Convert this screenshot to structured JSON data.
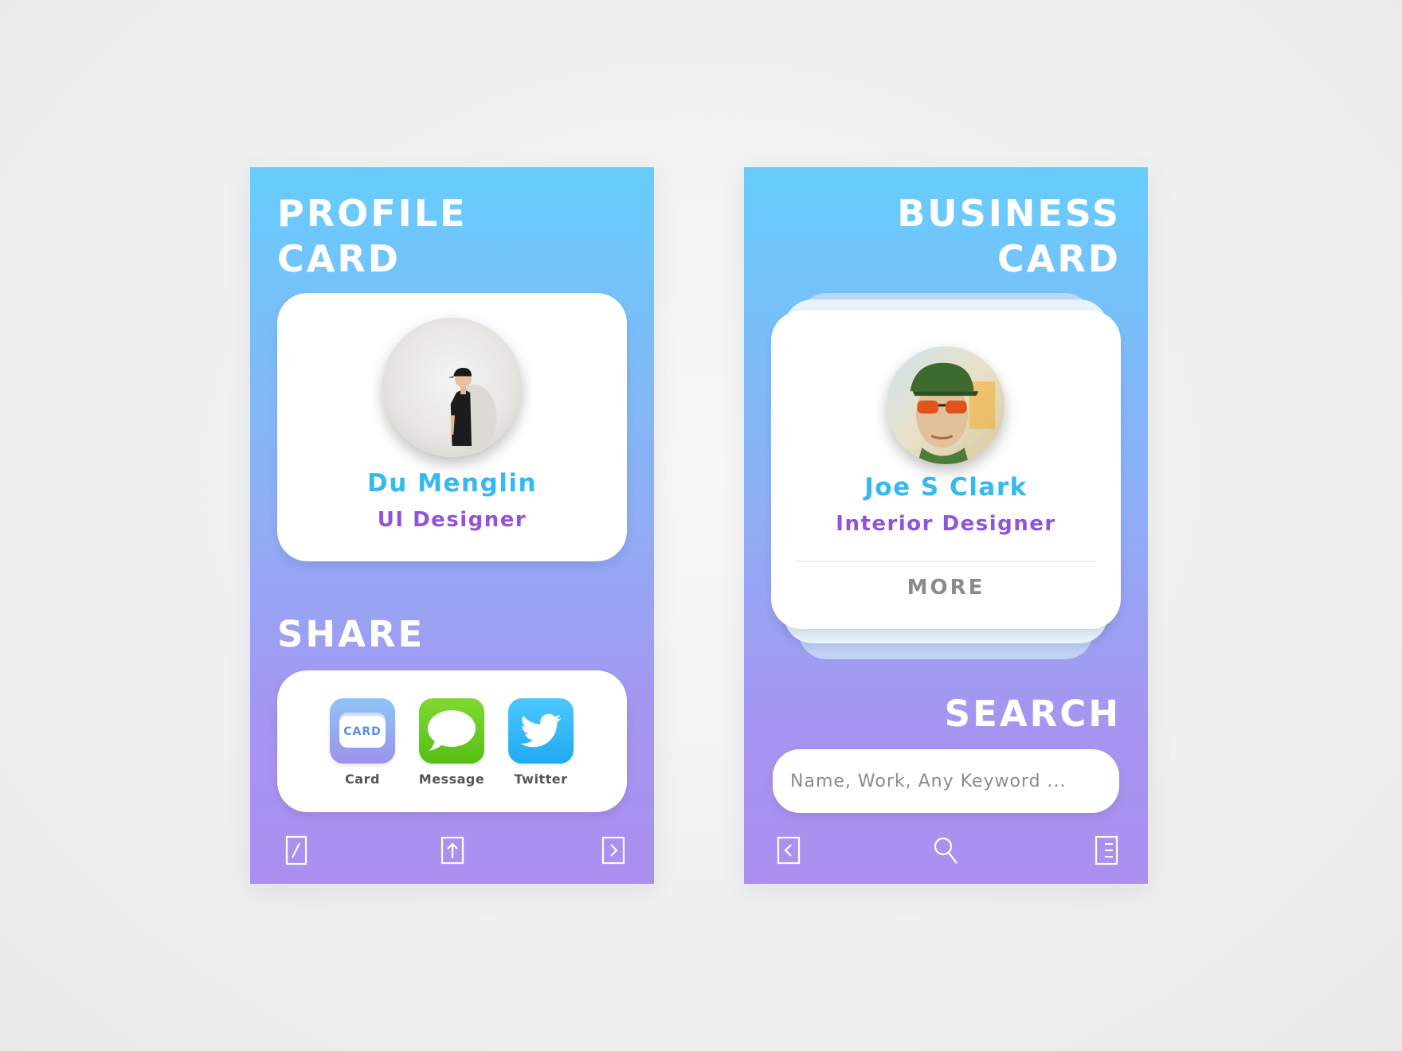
{
  "profile_screen": {
    "title_line1": "PROFILE",
    "title_line2": "CARD",
    "name": "Du Menglin",
    "role": "UI Designer",
    "share_title": "SHARE",
    "share_items": [
      {
        "label": "Card",
        "icon": "card-app-icon",
        "icon_text": "CARD"
      },
      {
        "label": "Message",
        "icon": "message-app-icon"
      },
      {
        "label": "Twitter",
        "icon": "twitter-app-icon"
      }
    ],
    "bottom_nav": [
      "edit-icon",
      "share-upload-icon",
      "forward-icon"
    ]
  },
  "business_screen": {
    "title_line1": "BUSINESS",
    "title_line2": "CARD",
    "name": "Joe S Clark",
    "role": "Interior Designer",
    "more_label": "MORE",
    "search_title": "SEARCH",
    "search_placeholder": "Name, Work, Any Keyword ...",
    "bottom_nav": [
      "back-icon",
      "search-icon",
      "list-icon"
    ]
  },
  "colors": {
    "gradient_top": "#66cdfd",
    "gradient_bottom": "#ab8fef",
    "name_blue": "#36b8f2",
    "role_purple": "#9452da",
    "message_green": "#62c81a",
    "twitter_blue": "#2cb7f7"
  }
}
